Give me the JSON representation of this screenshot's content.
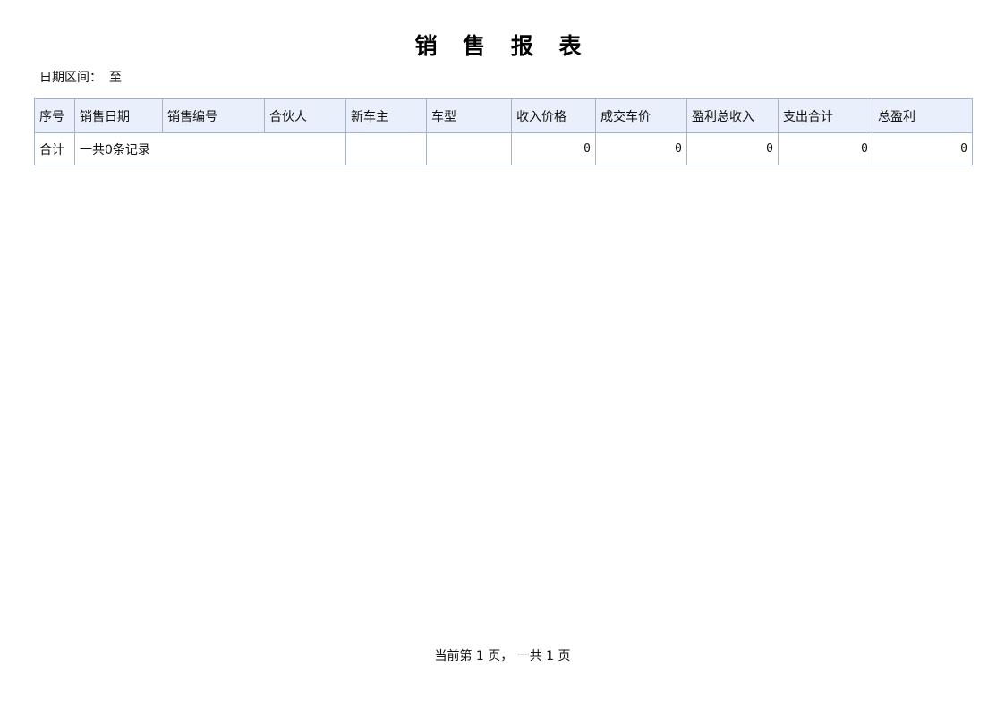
{
  "report": {
    "title": "销 售 报 表",
    "date_range_label": "日期区间：",
    "date_range_sep": "至"
  },
  "table": {
    "headers": [
      "序号",
      "销售日期",
      "销售编号",
      "合伙人",
      "新车主",
      "车型",
      "收入价格",
      "成交车价",
      "盈利总收入",
      "支出合计",
      "总盈利"
    ],
    "total_row": {
      "label": "合计",
      "record_count_text": "一共0条记录",
      "new_owner": "",
      "car_model": "",
      "income_price": "0",
      "deal_price": "0",
      "profit_income": "0",
      "expense_total": "0",
      "total_profit": "0"
    }
  },
  "pager": {
    "text": "当前第 1 页， 一共 1 页"
  }
}
